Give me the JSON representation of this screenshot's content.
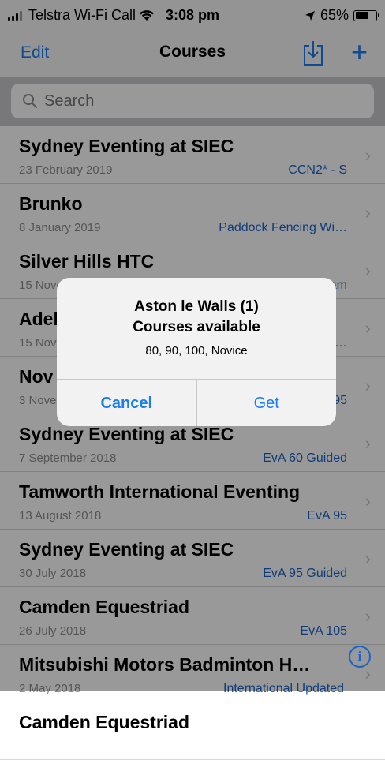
{
  "status_bar": {
    "carrier": "Telstra Wi-Fi Call",
    "time": "3:08 pm",
    "battery_text": "65%",
    "battery_level": 0.65
  },
  "nav": {
    "edit_label": "Edit",
    "title": "Courses",
    "download_icon": "download-tray-icon",
    "add_label": "+"
  },
  "search": {
    "placeholder": "Search"
  },
  "courses": [
    {
      "title": "Sydney Eventing at SIEC",
      "date": "23 February 2019",
      "tag": "CCN2* - S"
    },
    {
      "title": "Brunko",
      "date": "8 January 2019",
      "tag": "Paddock Fencing Wi…"
    },
    {
      "title": "Silver Hills  HTC",
      "date": "15 November 2018",
      "tag": "EVA 95 am"
    },
    {
      "title": "Adelaide",
      "date": "15 November 2018",
      "tag": "…"
    },
    {
      "title": "Nov",
      "date": "3 November 2018",
      "tag": "95"
    },
    {
      "title": "Sydney Eventing at SIEC",
      "date": "7 September 2018",
      "tag": "EvA 60 Guided"
    },
    {
      "title": "Tamworth International Eventing",
      "date": "13 August 2018",
      "tag": "EvA 95"
    },
    {
      "title": "Sydney Eventing at SIEC",
      "date": "30 July 2018",
      "tag": "EvA 95 Guided"
    },
    {
      "title": "Camden Equestriad",
      "date": "26 July 2018",
      "tag": "EvA 105"
    },
    {
      "title": "Mitsubishi Motors Badminton H…",
      "date": "2 May 2018",
      "tag": "International Updated"
    },
    {
      "title": "Camden Equestriad",
      "date": "",
      "tag": ""
    }
  ],
  "alert": {
    "title_line1": "Aston le Walls (1)",
    "title_line2": "Courses available",
    "message": "80, 90, 100, Novice",
    "cancel_label": "Cancel",
    "get_label": "Get"
  },
  "info_button_label": "i",
  "colors": {
    "accent": "#1a7cf5",
    "tag": "#1a64c8",
    "secondary_text": "#8e8e93"
  }
}
